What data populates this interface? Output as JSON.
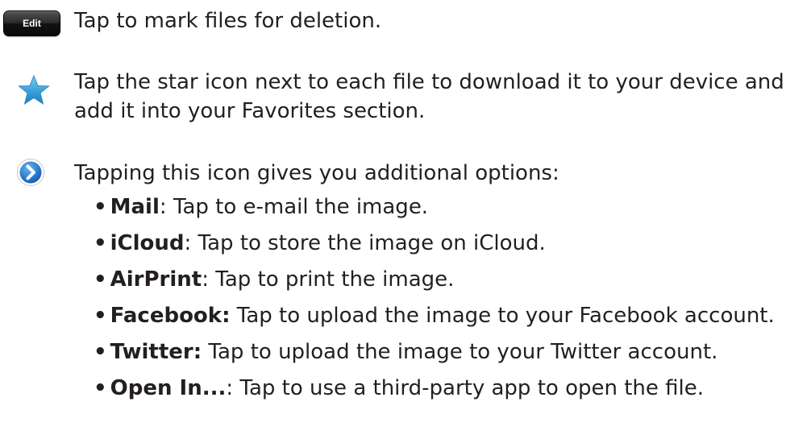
{
  "edit_row": {
    "button_label": "Edit",
    "description": "Tap to mark files for deletion."
  },
  "star_row": {
    "icon": "star-icon",
    "line1": "Tap the star icon next to each file to download it to your device and",
    "line2": "add it into your Favorites section."
  },
  "options_row": {
    "icon": "circle-chevron-right-icon",
    "intro": "Tapping this icon gives you additional options:",
    "bullet": "•",
    "items": [
      {
        "term": "Mail",
        "desc": ": Tap to e-mail the image."
      },
      {
        "term": "iCloud",
        "desc": ": Tap to store the image on iCloud."
      },
      {
        "term": "AirPrint",
        "desc": ": Tap to print the image."
      },
      {
        "term": "Facebook:",
        "desc": " Tap to upload the image to your Facebook account."
      },
      {
        "term": "Twitter:",
        "desc": " Tap to upload the image to your Twitter account."
      },
      {
        "term": "Open In...",
        "desc": ": Tap to use a third-party app to open the file."
      }
    ]
  },
  "colors": {
    "text": "#231f20",
    "star": "#3aa0d8",
    "chevron_circle": "#1f6fc0"
  }
}
